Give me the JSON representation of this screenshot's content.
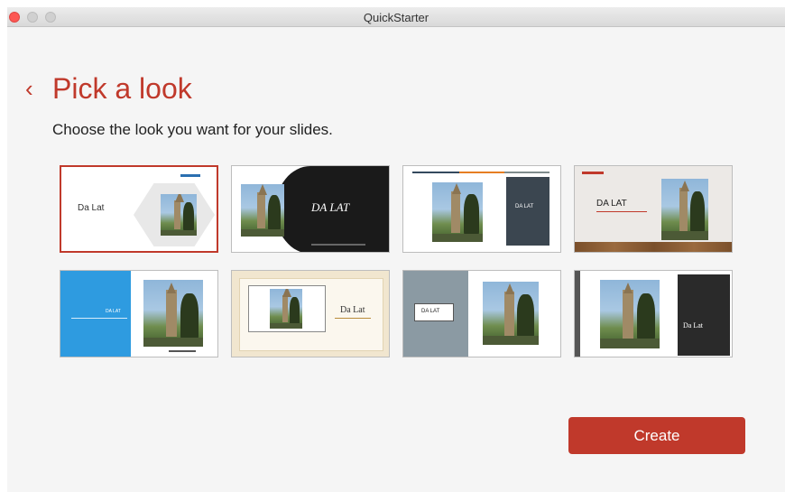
{
  "window": {
    "title": "QuickStarter"
  },
  "header": {
    "back_icon": "‹",
    "title": "Pick a look",
    "subtitle": "Choose the look you want for your slides."
  },
  "themes": [
    {
      "id": "theme-1",
      "text": "Da Lat",
      "selected": true
    },
    {
      "id": "theme-2",
      "text": "DA LAT"
    },
    {
      "id": "theme-3",
      "text": "DA LAT"
    },
    {
      "id": "theme-4",
      "text": "DA LAT"
    },
    {
      "id": "theme-5",
      "text": "DA LAT"
    },
    {
      "id": "theme-6",
      "text": "Da Lat"
    },
    {
      "id": "theme-7",
      "text": "DA LAT"
    },
    {
      "id": "theme-8",
      "text": "Da Lat"
    }
  ],
  "footer": {
    "create_label": "Create"
  },
  "colors": {
    "accent": "#c0392b"
  }
}
